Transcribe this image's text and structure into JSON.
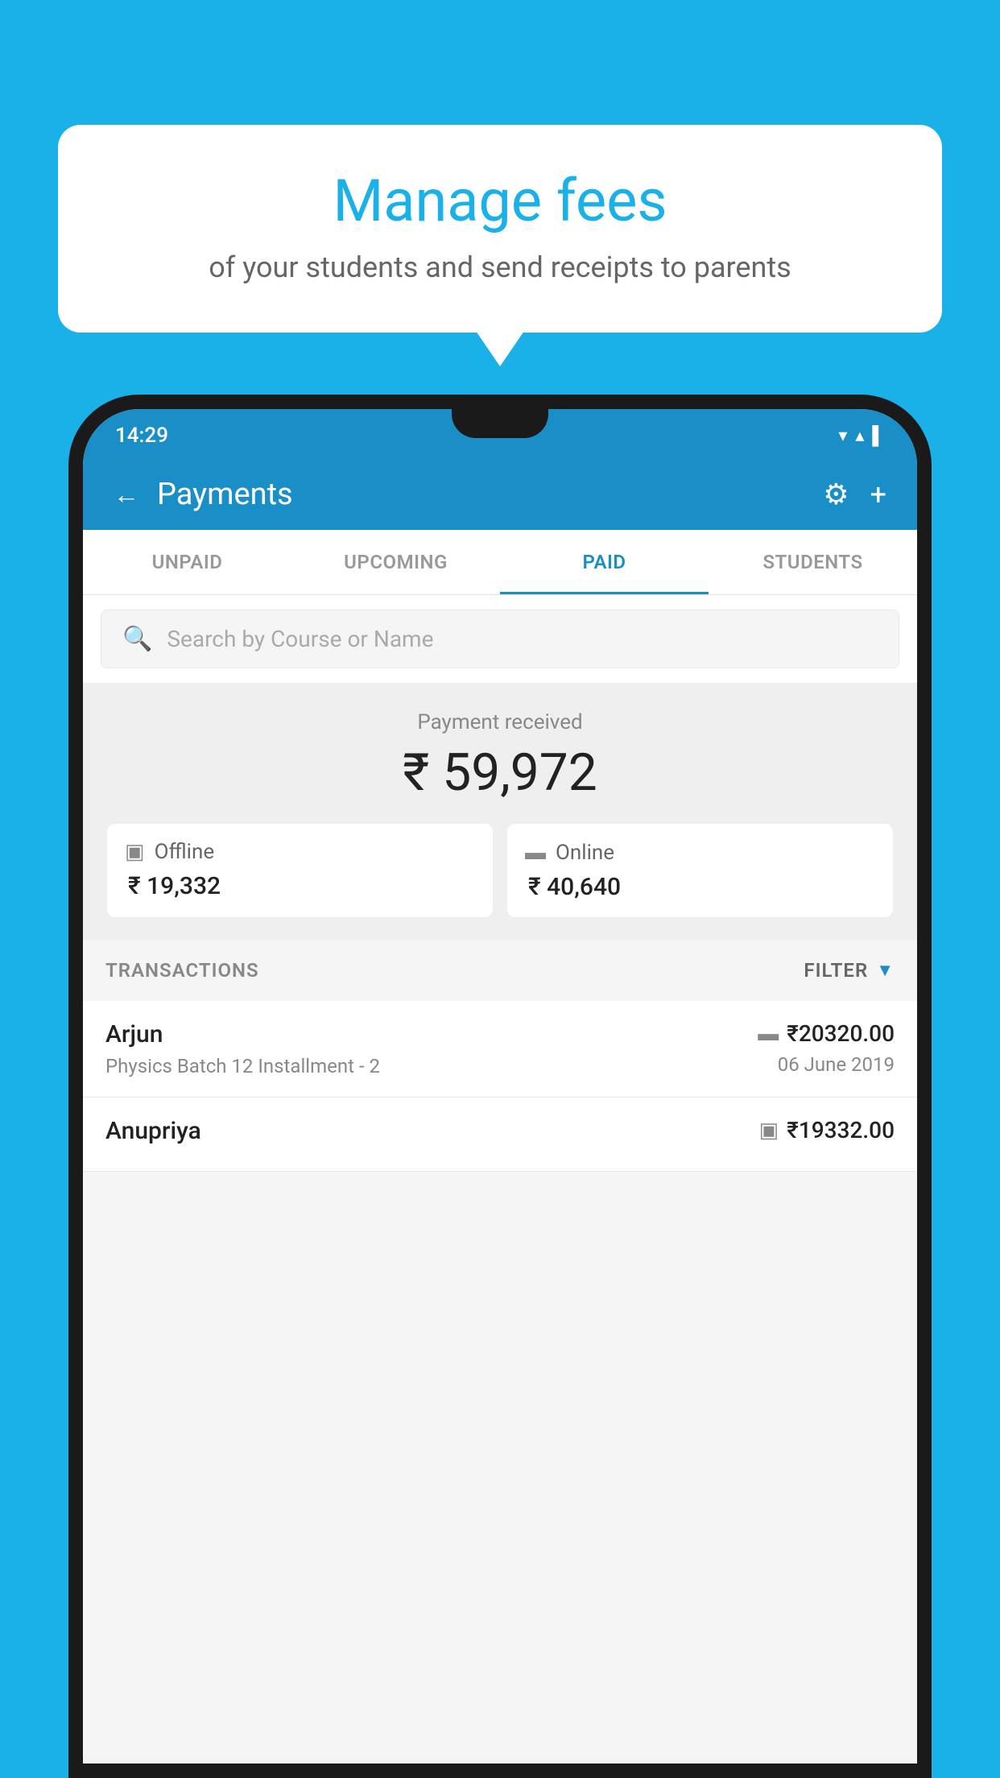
{
  "background_color": "#1ab0e8",
  "bubble": {
    "title": "Manage fees",
    "subtitle": "of your students and send receipts to parents"
  },
  "status_bar": {
    "time": "14:29",
    "icons": "▾ ▴ ▌"
  },
  "app_bar": {
    "back_label": "←",
    "title": "Payments",
    "settings_icon": "⚙",
    "add_icon": "+"
  },
  "tabs": [
    {
      "label": "UNPAID",
      "active": false
    },
    {
      "label": "UPCOMING",
      "active": false
    },
    {
      "label": "PAID",
      "active": true
    },
    {
      "label": "STUDENTS",
      "active": false
    }
  ],
  "search": {
    "placeholder": "Search by Course or Name"
  },
  "payment_received": {
    "label": "Payment received",
    "amount": "₹ 59,972",
    "offline": {
      "type": "Offline",
      "amount": "₹ 19,332"
    },
    "online": {
      "type": "Online",
      "amount": "₹ 40,640"
    }
  },
  "transactions": {
    "header_label": "TRANSACTIONS",
    "filter_label": "FILTER",
    "rows": [
      {
        "name": "Arjun",
        "detail": "Physics Batch 12 Installment - 2",
        "amount": "₹20320.00",
        "date": "06 June 2019",
        "payment_type": "online"
      },
      {
        "name": "Anupriya",
        "detail": "",
        "amount": "₹19332.00",
        "date": "",
        "payment_type": "offline"
      }
    ]
  }
}
